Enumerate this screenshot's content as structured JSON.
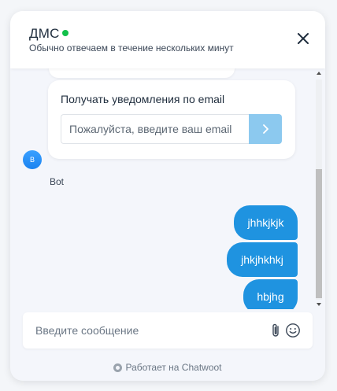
{
  "header": {
    "title": "ДМС",
    "subtitle": "Обычно отвечаем в течение нескольких минут",
    "online_color": "#12c04a",
    "close_icon": "close-icon"
  },
  "email_prompt": {
    "label": "Получать уведомления по email",
    "placeholder": "Пожалуйста, введите ваш email",
    "submit_icon": "chevron-right-icon"
  },
  "bot": {
    "avatar_letter": "B",
    "name": "Bot"
  },
  "user_messages": [
    {
      "text": "jhhkjkjk"
    },
    {
      "text": "jhkjhkhkj"
    },
    {
      "text": "hbjhg"
    }
  ],
  "composer": {
    "placeholder": "Введите сообщение",
    "attach_icon": "paperclip-icon",
    "emoji_icon": "smiley-icon"
  },
  "branding": {
    "text": "Работает на Chatwoot"
  },
  "colors": {
    "accent": "#1f93e0",
    "submit_button": "#8cc9ef"
  }
}
